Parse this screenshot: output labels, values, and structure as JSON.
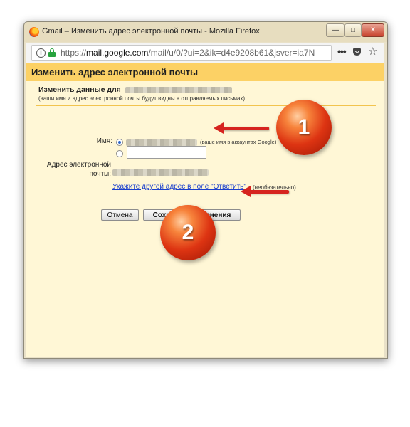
{
  "window": {
    "title": "Gmail – Изменить адрес электронной почты - Mozilla Firefox",
    "url": "https://mail.google.com/mail/u/0/?ui=2&ik=d4e9208b61&jsver=ia7N",
    "url_host": "mail.google.com",
    "min_glyph": "—",
    "max_glyph": "□",
    "close_glyph": "✕"
  },
  "toolbar": {
    "more_glyph": "•••",
    "star_glyph": "☆",
    "menu_glyph": "☰",
    "info_glyph": "i"
  },
  "page": {
    "header": "Изменить адрес электронной почты",
    "section_title": "Изменить данные для",
    "section_sub": "(ваши имя и адрес электронной почты будут видны в отправляемых письмах)",
    "name_label": "Имя:",
    "google_hint": "(ваше имя в аккаунтах Google)",
    "name_input_value": "",
    "email_label": "Адрес электронной почты:",
    "reply_link": "Укажите другой адрес в поле \"Ответить\"",
    "optional": "(необязательно)",
    "cancel_button": "Отмена",
    "save_button": "Сохранить изменения"
  },
  "annotations": {
    "badge1": "1",
    "badge2": "2",
    "badge_color": "#dd3412",
    "arrow_color": "#d6241f"
  }
}
